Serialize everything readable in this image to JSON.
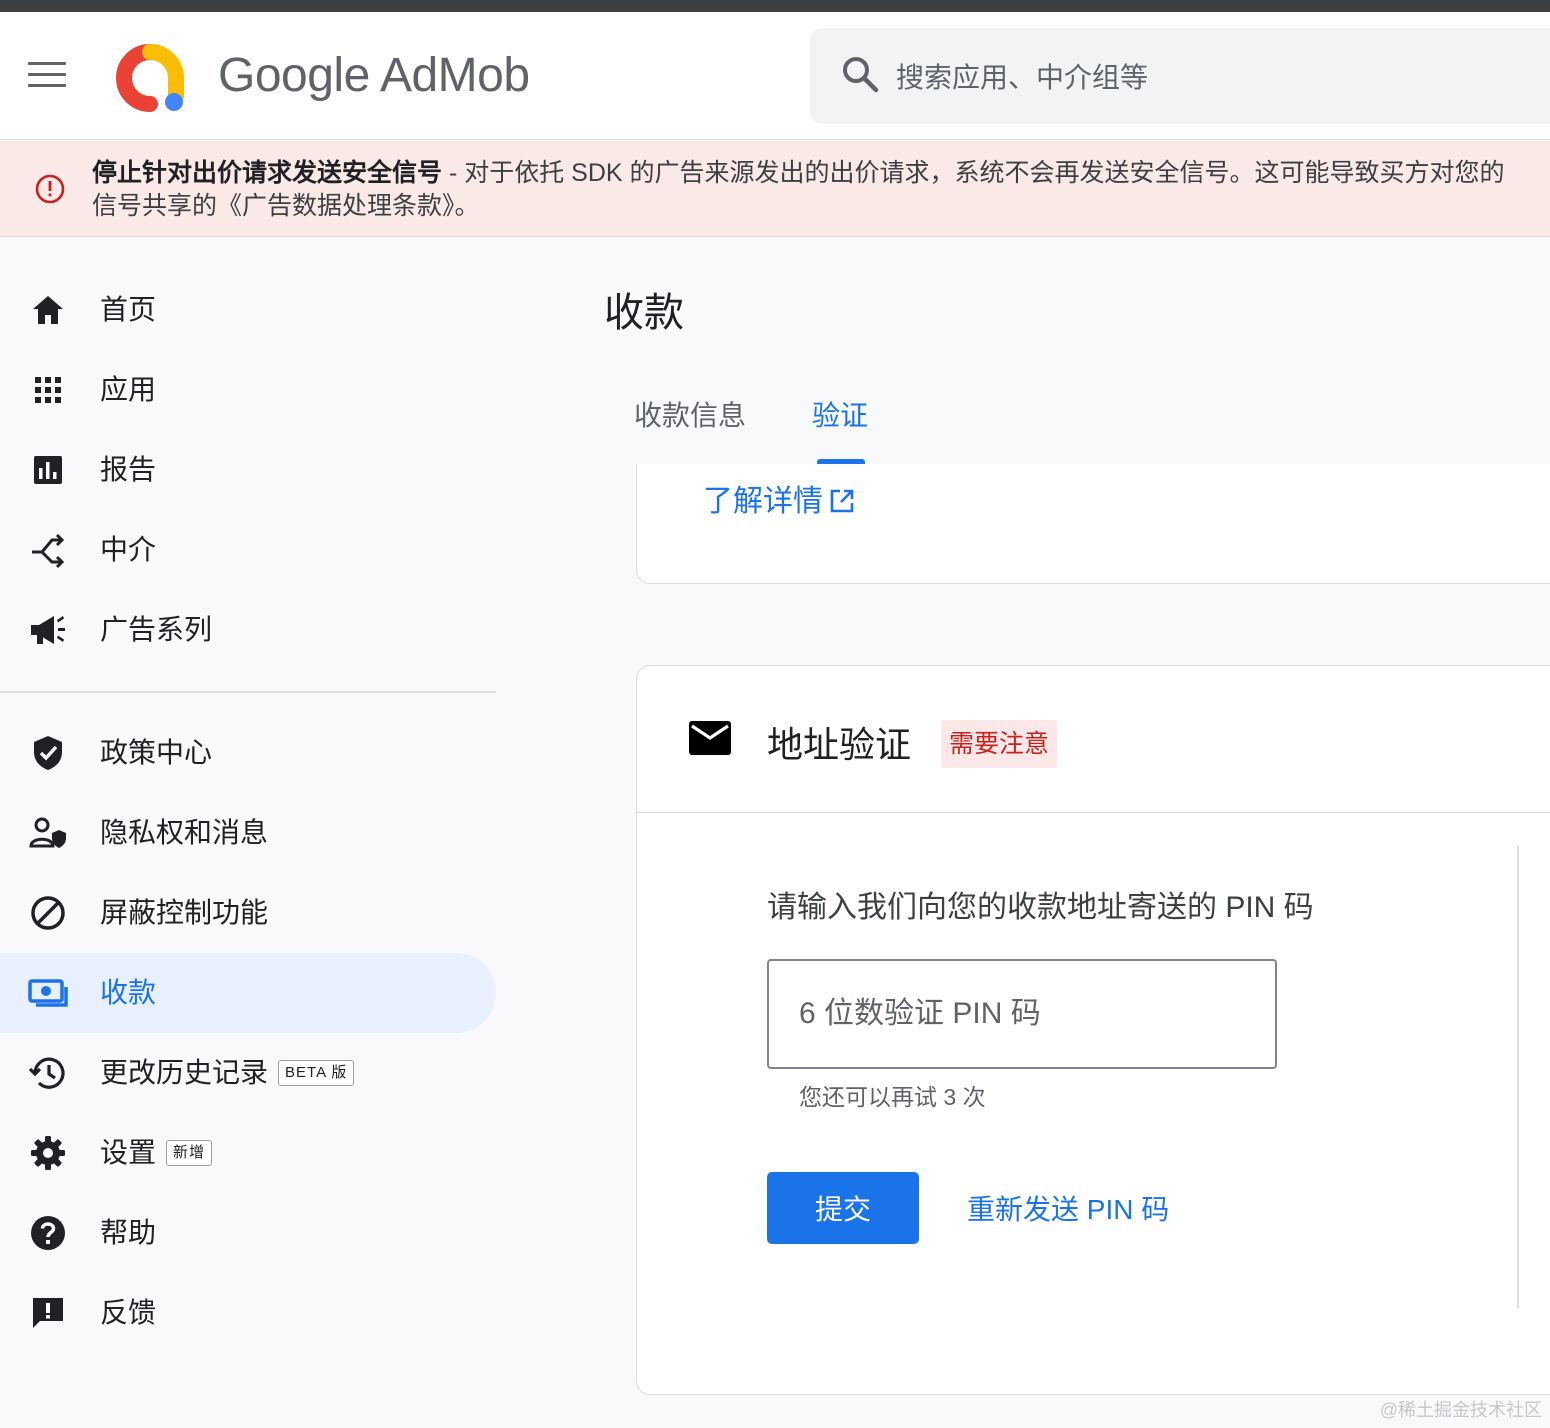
{
  "header": {
    "brand": "Google AdMob",
    "search_placeholder": "搜索应用、中介组等",
    "icons": {
      "menu": "hamburger-menu-icon",
      "logo": "admob-logo-icon",
      "search": "search-icon"
    },
    "logo_colors": [
      "#ea4335",
      "#fbbc04",
      "#4285f4"
    ]
  },
  "banner": {
    "icon": "error-circle-icon",
    "title": "停止针对出价请求发送安全信号",
    "body": " - 对于依托 SDK 的广告来源发出的出价请求，系统不会再发送安全信号。这可能导致买方对您的",
    "body_line2": "信号共享的《广告数据处理条款》。"
  },
  "sidebar": {
    "items": [
      {
        "label": "首页",
        "icon": "home-icon"
      },
      {
        "label": "应用",
        "icon": "apps-grid-icon"
      },
      {
        "label": "报告",
        "icon": "bar-chart-icon"
      },
      {
        "label": "中介",
        "icon": "merge-arrows-icon"
      },
      {
        "label": "广告系列",
        "icon": "megaphone-icon"
      },
      {
        "label": "政策中心",
        "icon": "shield-check-icon"
      },
      {
        "label": "隐私权和消息",
        "icon": "person-shield-icon"
      },
      {
        "label": "屏蔽控制功能",
        "icon": "block-icon"
      },
      {
        "label": "收款",
        "icon": "payments-icon",
        "active": true
      },
      {
        "label": "更改历史记录",
        "icon": "history-icon",
        "tag": "BETA 版"
      },
      {
        "label": "设置",
        "icon": "gear-icon",
        "tag": "新增"
      },
      {
        "label": "帮助",
        "icon": "help-circle-icon"
      },
      {
        "label": "反馈",
        "icon": "feedback-icon"
      }
    ]
  },
  "main": {
    "title": "收款",
    "tabs": [
      {
        "label": "收款信息"
      },
      {
        "label": "验证",
        "selected": true
      }
    ],
    "learn_more": "了解详情",
    "address_card": {
      "icon": "mail-icon",
      "title": "地址验证",
      "status": "需要注意",
      "prompt": "请输入我们向您的收款地址寄送的 PIN 码",
      "pin_placeholder": "6 位数验证 PIN 码",
      "pin_value": "",
      "helper": "您还可以再试 3 次",
      "submit_label": "提交",
      "resend_label": "重新发送 PIN 码"
    }
  },
  "watermark": "@稀土掘金技术社区",
  "colors": {
    "accent": "#1a73e8",
    "warning_bg": "#fbe9e7",
    "error": "#c5221f",
    "active_nav_bg": "#e8f0fe"
  }
}
